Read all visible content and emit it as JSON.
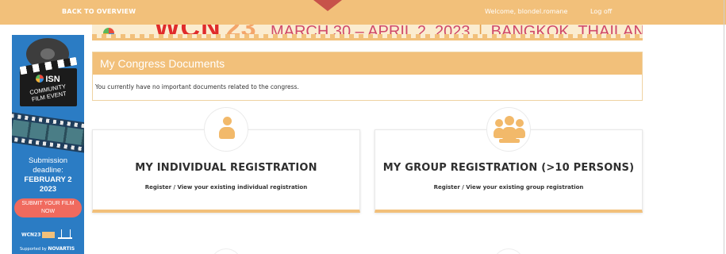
{
  "topbar": {
    "back_label": "BACK TO OVERVIEW",
    "welcome_text": "Welcome, blondel.romane",
    "logoff_label": "Log off"
  },
  "banner": {
    "word": "WCN",
    "year": "23",
    "dates": "MARCH 30 – APRIL 2, 2023",
    "separator": "|",
    "place": "BANGKOK, THAILAND"
  },
  "side_ad": {
    "org": "ISN",
    "event_line1": "COMMUNITY",
    "event_line2": "FILM EVENT",
    "submission_line1": "Submission",
    "submission_line2": "deadline:",
    "deadline_line1": "FEBRUARY 2",
    "deadline_line2": "2023",
    "cta_line1": "SUBMIT YOUR FILM",
    "cta_line2": "NOW",
    "mini_logo": "WCN23",
    "supported_prefix": "Supported by",
    "sponsor": "NOVARTIS"
  },
  "documents": {
    "title": "My Congress Documents",
    "message": "You currently have no important documents related to the congress."
  },
  "registration": {
    "individual": {
      "title": "MY INDIVIDUAL REGISTRATION",
      "subtitle": "Register / View your existing individual registration",
      "icon": "person-icon"
    },
    "group": {
      "title": "MY GROUP REGISTRATION (>10 PERSONS)",
      "subtitle": "Register / View your existing group registration",
      "icon": "group-icon"
    }
  },
  "colors": {
    "accent": "#f2c07a",
    "icon": "#f2b96a",
    "ad_blue": "#2b7cc4",
    "cta": "#f06a5e"
  }
}
